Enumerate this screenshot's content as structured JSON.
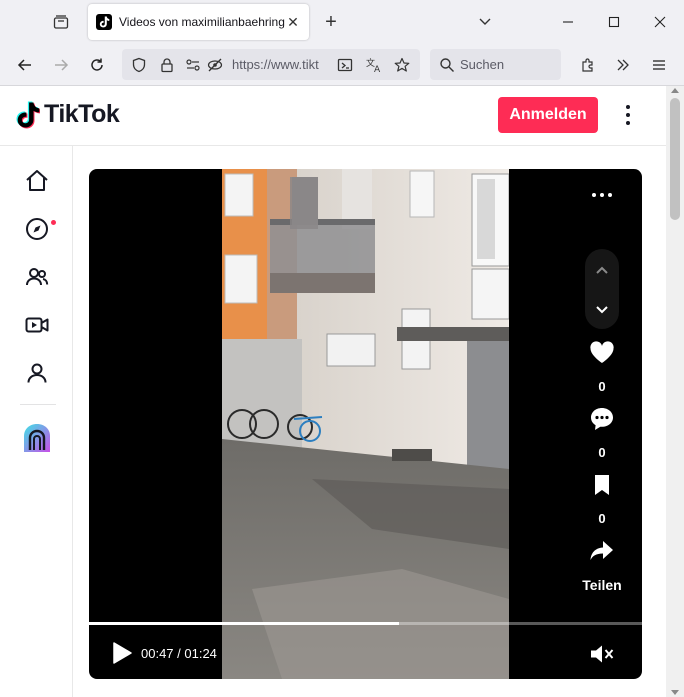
{
  "browser": {
    "tab_title": "Videos von maximilianbaehring",
    "url": "https://www.tikt",
    "search_placeholder": "Suchen",
    "icons": {
      "tab_list": "tab-list-icon",
      "close_tab": "close-icon",
      "new_tab": "plus-icon",
      "tabs_menu": "chevron-down-icon",
      "minimize": "minimize-icon",
      "maximize": "maximize-icon",
      "close_window": "close-icon",
      "back": "arrow-left-icon",
      "forward": "arrow-right-icon",
      "reload": "reload-icon",
      "shield": "shield-icon",
      "lock": "lock-icon",
      "permissions": "permissions-icon",
      "tracking": "tracking-blocked-icon",
      "reader": "reader-mode-icon",
      "translate": "translate-icon",
      "bookmark": "star-icon",
      "search": "search-icon",
      "extensions": "extensions-icon",
      "overflow": "chevron-double-right-icon",
      "menu": "hamburger-menu-icon"
    }
  },
  "header": {
    "logo_text": "TikTok",
    "login_label": "Anmelden"
  },
  "sidebar": {
    "items": [
      {
        "name": "home",
        "icon": "home-icon"
      },
      {
        "name": "explore",
        "icon": "compass-icon",
        "has_notification_dot": true
      },
      {
        "name": "following",
        "icon": "users-icon"
      },
      {
        "name": "live",
        "icon": "live-video-icon"
      },
      {
        "name": "profile",
        "icon": "user-icon"
      },
      {
        "name": "creator",
        "icon": "arch-logo-icon"
      }
    ]
  },
  "video": {
    "current_time": "00:47",
    "duration": "01:24",
    "time_display": "00:47 / 01:24",
    "progress_fraction": 0.56,
    "muted": true
  },
  "actions": {
    "likes": "0",
    "comments": "0",
    "saves": "0",
    "share_label": "Teilen"
  },
  "colors": {
    "brand_red": "#fe2c55",
    "text": "#161823",
    "chrome_bg": "#f0f0f4"
  }
}
